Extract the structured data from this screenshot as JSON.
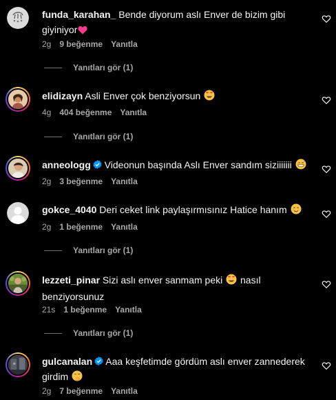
{
  "comments": [
    {
      "username": "funda_karahan_",
      "verified": false,
      "text": "Bende diyorum aslı Enver de bizim gibi giyiniyor",
      "emoji": "heart",
      "time": "2g",
      "likes": "9 beğenme",
      "reply": "Yanıtla",
      "replies_label": "Yanıtları gör (1)"
    },
    {
      "username": "elidizayn",
      "verified": false,
      "text": "Asli Enver çok benziyorsun",
      "emoji": "heart-eyes",
      "time": "4g",
      "likes": "404 beğenme",
      "reply": "Yanıtla",
      "replies_label": "Yanıtları gör (1)"
    },
    {
      "username": "anneologg",
      "verified": true,
      "text": "Videonun başında Aslı Enver sandım siziiiiiii",
      "emoji": "grin-sweat",
      "time": "2g",
      "likes": "3 beğenme",
      "reply": "Yanıtla",
      "replies_label": ""
    },
    {
      "username": "gokce_4040",
      "verified": false,
      "text": "Deri ceket link paylaşırmısınız Hatice hanım",
      "emoji": "smiling",
      "time": "2g",
      "likes": "1 beğenme",
      "reply": "Yanıtla",
      "replies_label": "Yanıtları gör (1)"
    },
    {
      "username": "lezzeti_pinar",
      "verified": false,
      "text_before": "Sizi aslı enver sanmam peki",
      "text_after": "nasıl benziyorsunuz",
      "emoji": "heart-eyes",
      "time": "21s",
      "likes": "1 beğenme",
      "reply": "Yanıtla",
      "replies_label": "Yanıtları gör (1)"
    },
    {
      "username": "gulcanalan",
      "verified": true,
      "text": "Aaa keşfetimde gördüm aslı enver zannederek girdim",
      "emoji": "hand-over-mouth",
      "time": "2g",
      "likes": "7 beğenme",
      "reply": "Yanıtla",
      "replies_label": ""
    }
  ],
  "colors": {
    "background": "#000000",
    "primary_text": "#f5f5f5",
    "secondary_text": "#a8a8a8",
    "verified_blue": "#0095f6",
    "heart_pink": "#ff3b8d"
  },
  "icons": {
    "like": "heart-outline-icon",
    "verified": "verified-badge-icon"
  }
}
